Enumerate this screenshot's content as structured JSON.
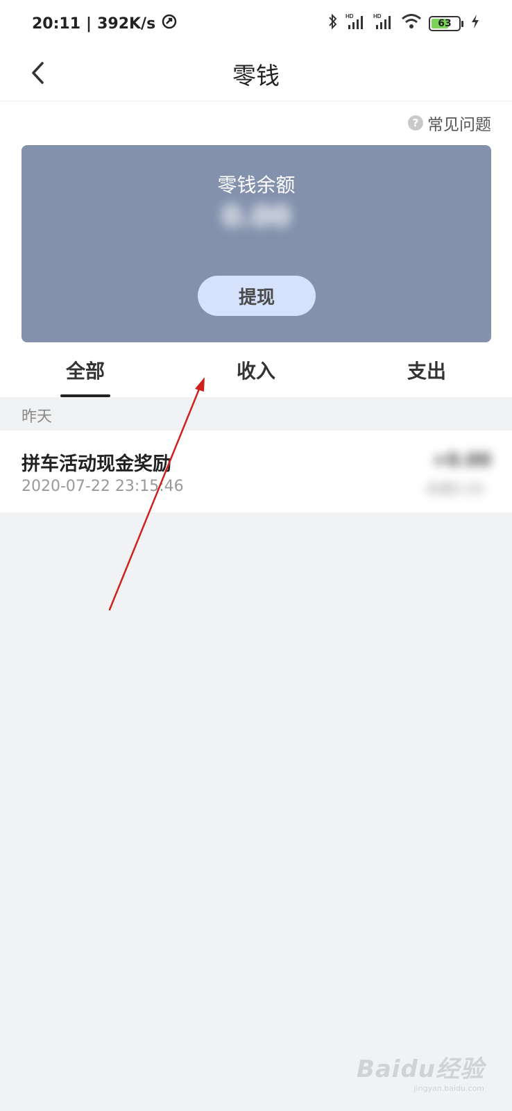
{
  "status_bar": {
    "time": "20:11",
    "speed": "392K/s",
    "battery": "63",
    "battery_level": 0.63,
    "icons": [
      "at-icon",
      "bluetooth-icon",
      "signal-hd-icon",
      "signal-hd-icon",
      "wifi-icon",
      "battery-icon",
      "charging-icon"
    ]
  },
  "nav": {
    "title": "零钱",
    "back_icon": "chevron-left-icon"
  },
  "faq": {
    "label": "常见问题",
    "icon_text": "?"
  },
  "balance_card": {
    "label": "零钱余额",
    "amount": "0.00",
    "withdraw_label": "提现"
  },
  "tabs": [
    {
      "label": "全部",
      "active": true
    },
    {
      "label": "收入",
      "active": false
    },
    {
      "label": "支出",
      "active": false
    }
  ],
  "records": {
    "date_header": "昨天",
    "items": [
      {
        "title": "拼车活动现金奖励",
        "time": "2020-07-22 23:15:46",
        "amount": "+0.00",
        "balance": "余额0.00"
      }
    ]
  },
  "watermark": {
    "main": "Baidu经验",
    "sub": "jingyan.baidu.com"
  },
  "colors": {
    "card": "#8391ad",
    "button": "#d6e2fb",
    "page_bg": "#f1f2f4",
    "annotation_arrow": "#d0201e"
  }
}
